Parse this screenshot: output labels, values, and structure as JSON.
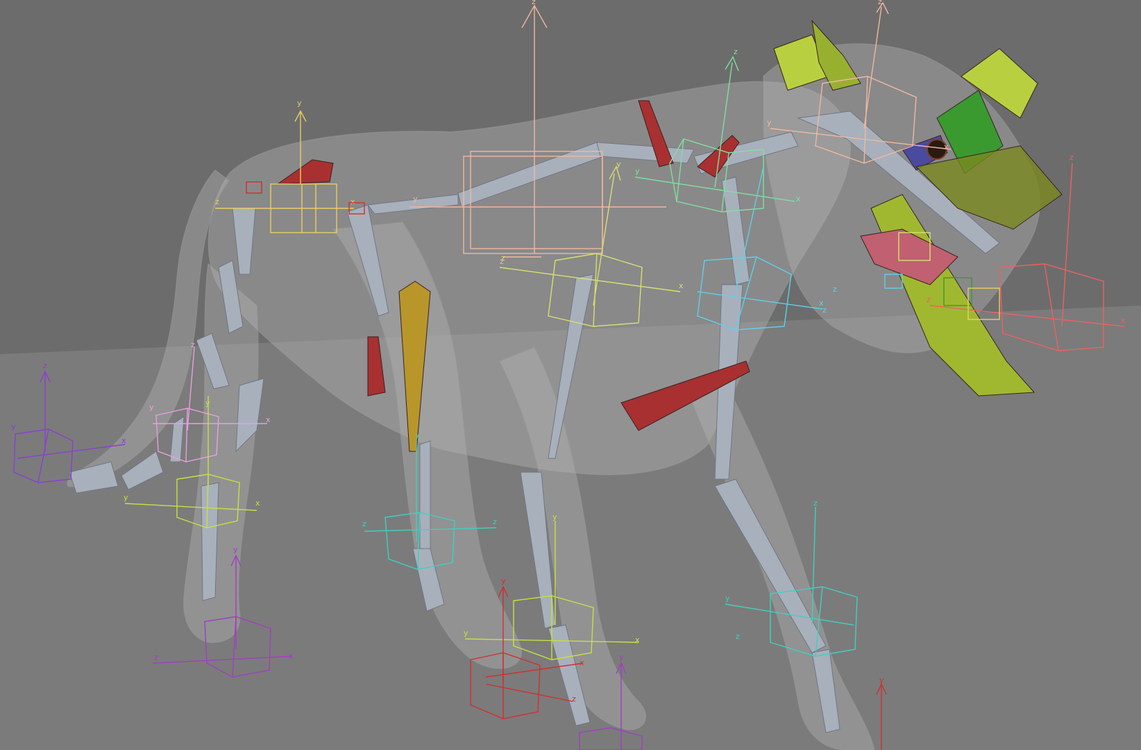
{
  "viewport": {
    "active_border_color": "#b8a04a",
    "background_upper": "#707070",
    "background_floor": "#7a7a7a"
  },
  "helpers": [
    {
      "id": "spine-root",
      "color": "#f0b8a0",
      "labels": [
        "y",
        "z",
        "z"
      ]
    },
    {
      "id": "pelvis",
      "color": "#e8d060",
      "labels": [
        "y",
        "z",
        "x"
      ]
    },
    {
      "id": "neck",
      "color": "#7fe0a0",
      "labels": [
        "z",
        "y",
        "x"
      ]
    },
    {
      "id": "head",
      "color": "#f0b8a0",
      "labels": [
        "z",
        "y",
        "x"
      ]
    },
    {
      "id": "chest",
      "color": "#d8e070",
      "labels": [
        "y",
        "z",
        "x"
      ]
    },
    {
      "id": "front-shoulder",
      "color": "#60d0e8",
      "labels": [
        "z",
        "z",
        "x"
      ]
    },
    {
      "id": "jaw",
      "color": "#f06060",
      "labels": [
        "z",
        "z",
        "x"
      ]
    },
    {
      "id": "tail-tip",
      "color": "#8a40d0",
      "labels": [
        "z",
        "y",
        "x"
      ]
    },
    {
      "id": "tail-mid",
      "color": "#e8a0e0",
      "labels": [
        "y",
        "z",
        "x"
      ]
    },
    {
      "id": "rear-knee",
      "color": "#c8e040",
      "labels": [
        "y",
        "x",
        "y"
      ]
    },
    {
      "id": "rear-foot",
      "color": "#a040c0",
      "labels": [
        "y",
        "z",
        "x"
      ]
    },
    {
      "id": "hind-ankle",
      "color": "#40d0c0",
      "labels": [
        "y",
        "z",
        "z"
      ]
    },
    {
      "id": "front-paw-left",
      "color": "#c8e040",
      "labels": [
        "y",
        "x",
        "y"
      ]
    },
    {
      "id": "front-paw-red",
      "color": "#d03030",
      "labels": [
        "y",
        "x",
        "z"
      ]
    },
    {
      "id": "front-paw-purple",
      "color": "#a040c0",
      "labels": [
        "y"
      ]
    },
    {
      "id": "front-right-leg",
      "color": "#40d0c0",
      "labels": [
        "z",
        "y",
        "z"
      ]
    },
    {
      "id": "right-foot-red",
      "color": "#d03030",
      "labels": [
        "y"
      ]
    }
  ]
}
